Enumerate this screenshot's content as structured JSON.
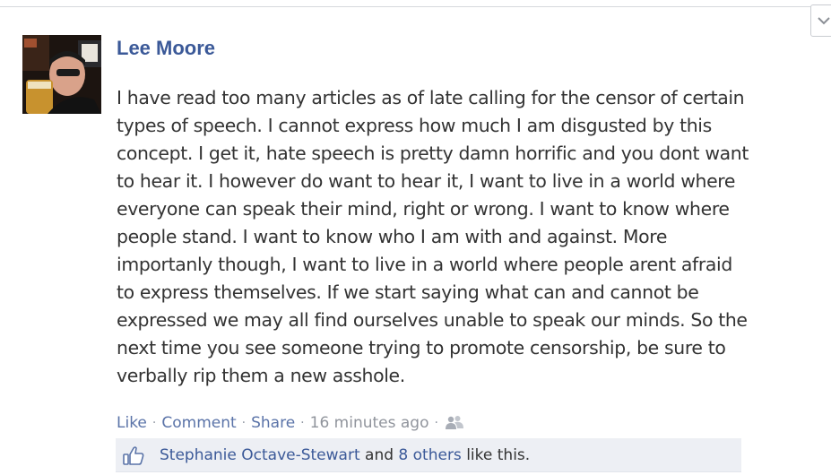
{
  "post": {
    "author": "Lee Moore",
    "lines": [
      "I have read too many articles as of late calling for the censor of certain",
      "types of speech. I cannot express how much I am disgusted by this",
      "concept. I get it, hate speech is pretty damn horrific and you dont want",
      "to hear it. I however do want to hear it, I want to live in a world where",
      "everyone can speak their mind, right or wrong. I want to know where",
      "people stand. I want to know who I am with and against. More",
      "importanly though, I want to live in a world where people arent afraid",
      "to express themselves. If we start saying what can and cannot be",
      "expressed we may all find ourselves unable to speak our minds. So the",
      "next time you see someone trying to promote censorship, be sure to",
      "verbally rip them a new asshole."
    ]
  },
  "actions": {
    "like": "Like",
    "comment": "Comment",
    "share": "Share",
    "timestamp": "16 minutes ago",
    "separator": "·",
    "audience_icon": "friends-icon"
  },
  "likes": {
    "person": "Stephanie Octave-Stewart",
    "conjunction": " and ",
    "others": "8 others",
    "suffix": " like this.",
    "icon": "thumbs-up-icon"
  },
  "colors": {
    "link": "#3b5998",
    "text": "#333333",
    "muted": "#90949c",
    "likes_bg": "#edeff4"
  }
}
